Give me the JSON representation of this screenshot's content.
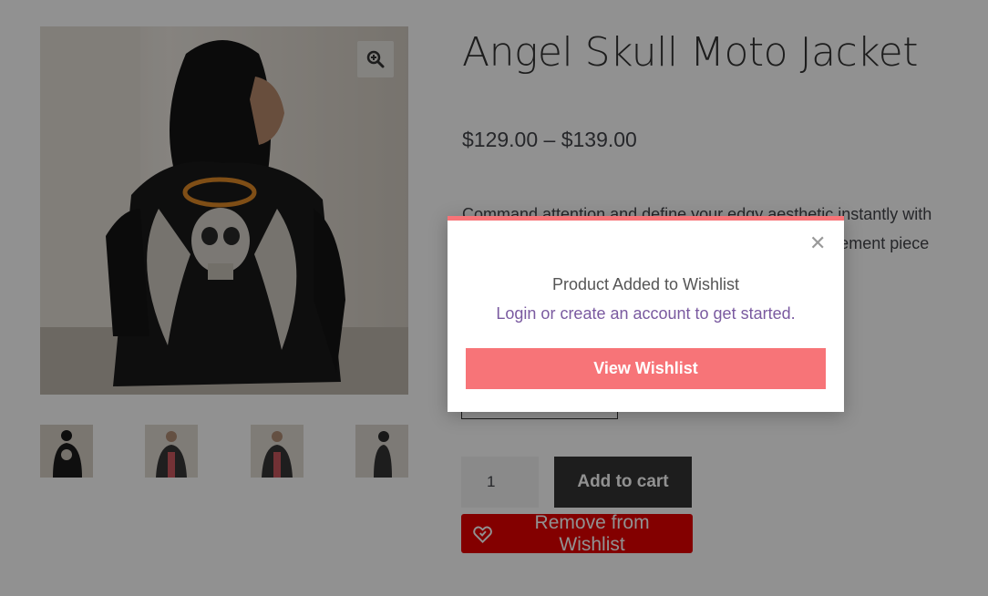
{
  "product": {
    "title": "Angel Skull Moto Jacket",
    "price": "$129.00 – $139.00",
    "description": "Command attention and define your edgy aesthetic instantly with this striking angel skull moto jacket, the ultimate statement piece for your wardrobe.",
    "quantity": "1",
    "add_to_cart_label": "Add to cart",
    "remove_wishlist_label": "Remove from Wishlist"
  },
  "gallery": {
    "zoom_icon": "zoom-in-icon",
    "thumbnails": [
      "thumbnail-1",
      "thumbnail-2",
      "thumbnail-3",
      "thumbnail-4"
    ]
  },
  "modal": {
    "title": "Product Added to Wishlist",
    "link_text": "Login or create an account to get started.",
    "button_label": "View Wishlist",
    "close_icon": "close-icon"
  },
  "colors": {
    "accent": "#f77478",
    "wishlist_button": "#e60000",
    "link": "#7a5aa0",
    "cart_button": "#333333"
  }
}
